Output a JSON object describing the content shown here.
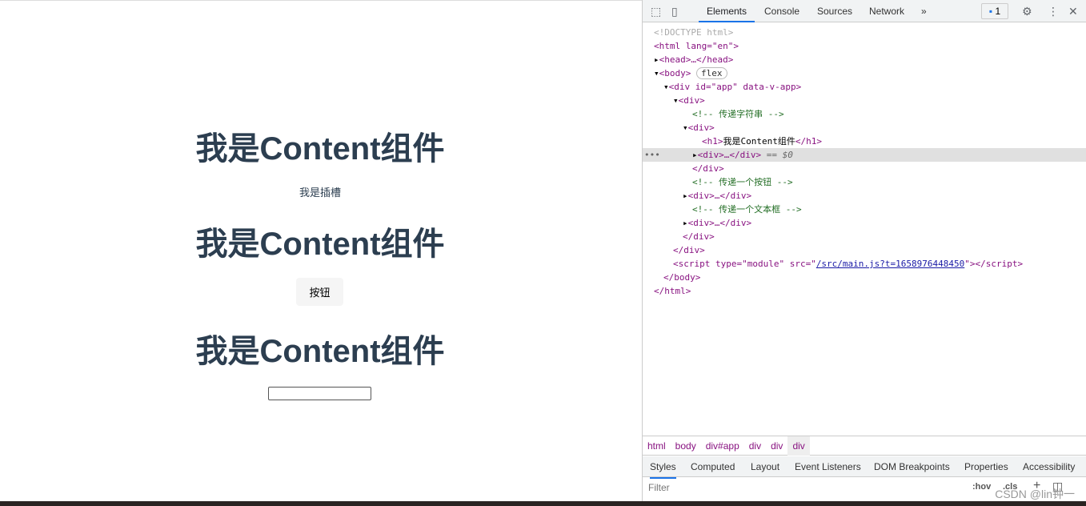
{
  "page": {
    "heading": "我是Content组件",
    "slot_text": "我是插槽",
    "button_label": "按钮",
    "input_value": ""
  },
  "devtools": {
    "tabs": [
      "Elements",
      "Console",
      "Sources",
      "Network"
    ],
    "more": "»",
    "issues_count": "1",
    "tree": [
      "<!DOCTYPE html>",
      "<html lang=\"en\">",
      "<head>…</head>",
      "<body>",
      "flex",
      "<div id=\"app\" data-v-app>",
      "<div>",
      "<!-- 传递字符串 -->",
      "<div>",
      "<h1>",
      "我是Content组件",
      "</h1>",
      "<div>…</div>",
      " == $0",
      "</div>",
      "<!-- 传递一个按钮 -->",
      "<div>…</div>",
      "<!-- 传递一个文本框 -->",
      "<div>…</div>",
      "</div>",
      "</div>",
      "<script type=\"module\" src=\"",
      "/src/main.js?t=1658976448450",
      "\"></script>",
      "</body>",
      "</html>"
    ],
    "breadcrumbs": [
      "html",
      "body",
      "div#app",
      "div",
      "div",
      "div"
    ],
    "subtabs": [
      "Styles",
      "Computed",
      "Layout",
      "Event Listeners",
      "DOM Breakpoints",
      "Properties",
      "Accessibility"
    ],
    "filter_placeholder": "Filter",
    "hov": ":hov",
    "cls": ".cls"
  },
  "watermark": "CSDN @lin钟一"
}
